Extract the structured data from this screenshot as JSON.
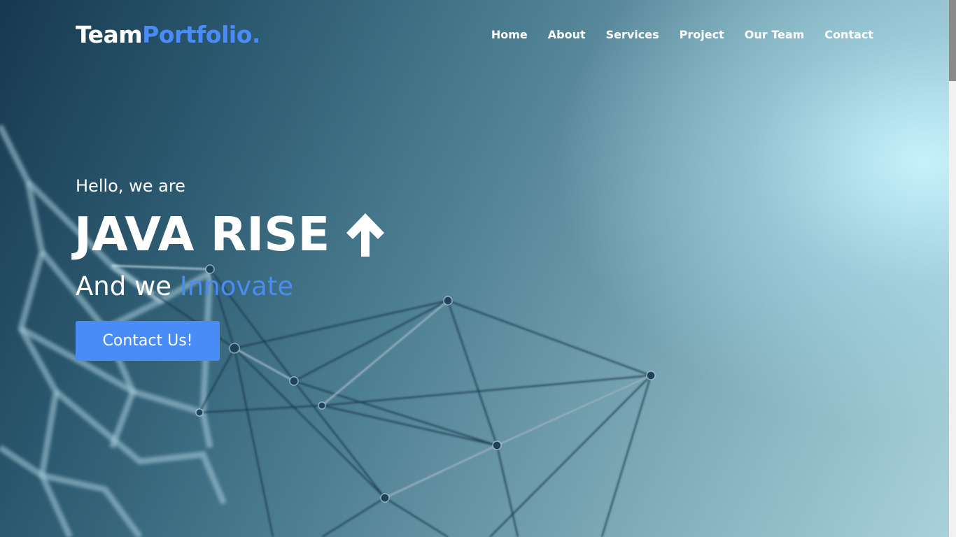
{
  "header": {
    "logo_main": "Team",
    "logo_accent": "Portfolio.",
    "nav": [
      "Home",
      "About",
      "Services",
      "Project",
      "Our Team",
      "Contact"
    ]
  },
  "hero": {
    "greeting": "Hello, we are",
    "headline": "JAVA RISE",
    "headline_icon": "arrow-up-icon",
    "tagline_prefix": "And we",
    "tagline_accent": "Innovate",
    "cta_label": "Contact Us!"
  },
  "colors": {
    "accent": "#4a8cf7",
    "text": "#ffffff"
  }
}
